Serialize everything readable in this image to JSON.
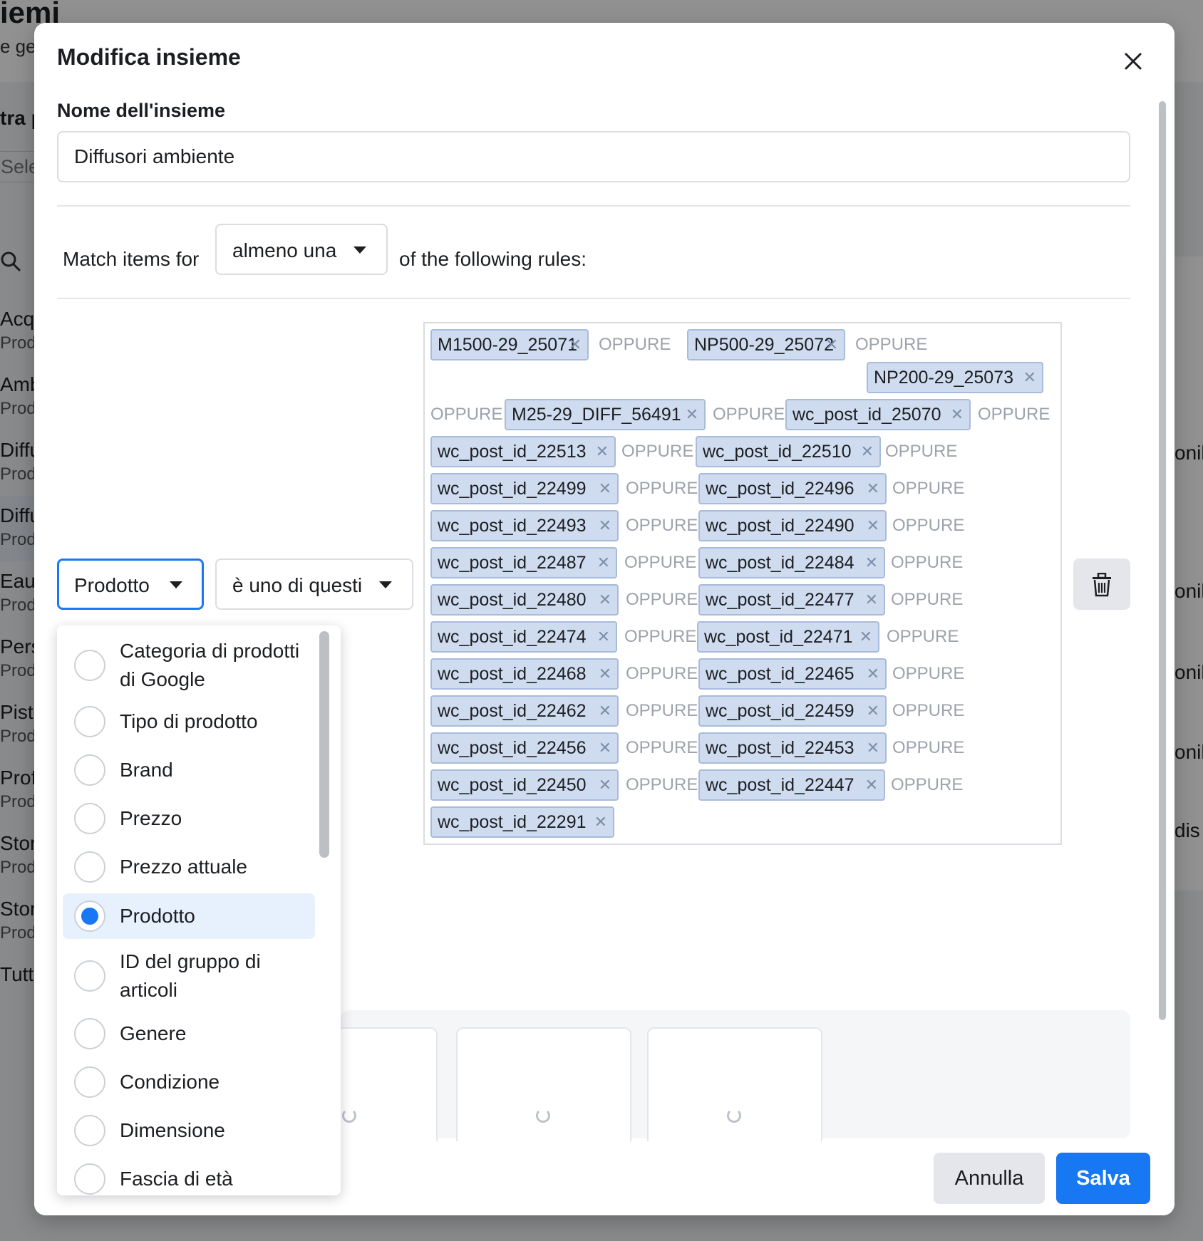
{
  "background": {
    "title": "iemi",
    "subtitle": "e ge",
    "filter_label": "tra p",
    "select_placeholder": "Sele",
    "list": [
      {
        "name": "Acqu",
        "sub": "Prodo"
      },
      {
        "name": "Amb",
        "sub": "Prodo"
      },
      {
        "name": "Diffu",
        "sub": "Prodo"
      },
      {
        "name": "Diffu",
        "sub": "Prodo"
      },
      {
        "name": "Eau c",
        "sub": "Prodo"
      },
      {
        "name": "Perso",
        "sub": "Prodo"
      },
      {
        "name": "Pisto",
        "sub": "Prodo"
      },
      {
        "name": "Profu",
        "sub": "Prodo"
      },
      {
        "name": "Store",
        "sub": "Prodo"
      },
      {
        "name": "Store",
        "sub": "Prodo"
      },
      {
        "name": "Tutti",
        "sub": ""
      }
    ],
    "right_labels": [
      "onil",
      "onil",
      "onil",
      "onil",
      "dis"
    ]
  },
  "dialog": {
    "title": "Modifica insieme",
    "name_label": "Nome dell'insieme",
    "name_value": "Diffusori ambiente",
    "match_prefix": "Match items for",
    "match_value": "almeno una",
    "match_suffix": "of the following rules:",
    "rule": {
      "field": "Prodotto",
      "operator": "è uno di questi",
      "separator": "OPPURE",
      "values": [
        "M1500-29_25071",
        "NP500-29_25072",
        "NP200-29_25073",
        "M25-29_DIFF_56491",
        "wc_post_id_25070",
        "wc_post_id_22513",
        "wc_post_id_22510",
        "wc_post_id_22499",
        "wc_post_id_22496",
        "wc_post_id_22493",
        "wc_post_id_22490",
        "wc_post_id_22487",
        "wc_post_id_22484",
        "wc_post_id_22480",
        "wc_post_id_22477",
        "wc_post_id_22474",
        "wc_post_id_22471",
        "wc_post_id_22468",
        "wc_post_id_22465",
        "wc_post_id_22462",
        "wc_post_id_22459",
        "wc_post_id_22456",
        "wc_post_id_22453",
        "wc_post_id_22450",
        "wc_post_id_22447",
        "wc_post_id_22291"
      ]
    },
    "field_options": [
      {
        "label": "Categoria di prodotti di Google",
        "selected": false
      },
      {
        "label": "Tipo di prodotto",
        "selected": false
      },
      {
        "label": "Brand",
        "selected": false
      },
      {
        "label": "Prezzo",
        "selected": false
      },
      {
        "label": "Prezzo attuale",
        "selected": false
      },
      {
        "label": "Prodotto",
        "selected": true
      },
      {
        "label": "ID del gruppo di articoli",
        "selected": false
      },
      {
        "label": "Genere",
        "selected": false
      },
      {
        "label": "Condizione",
        "selected": false
      },
      {
        "label": "Dimensione",
        "selected": false
      },
      {
        "label": "Fascia di età",
        "selected": false
      }
    ],
    "cancel_label": "Annulla",
    "save_label": "Salva"
  },
  "colors": {
    "accent": "#1877f2",
    "token_bg": "#cfdcf0",
    "separator": "#9da3ab"
  },
  "icons": [
    "close-icon",
    "caret-down-icon",
    "trash-icon",
    "token-remove-icon",
    "search-icon",
    "spinner-icon"
  ]
}
